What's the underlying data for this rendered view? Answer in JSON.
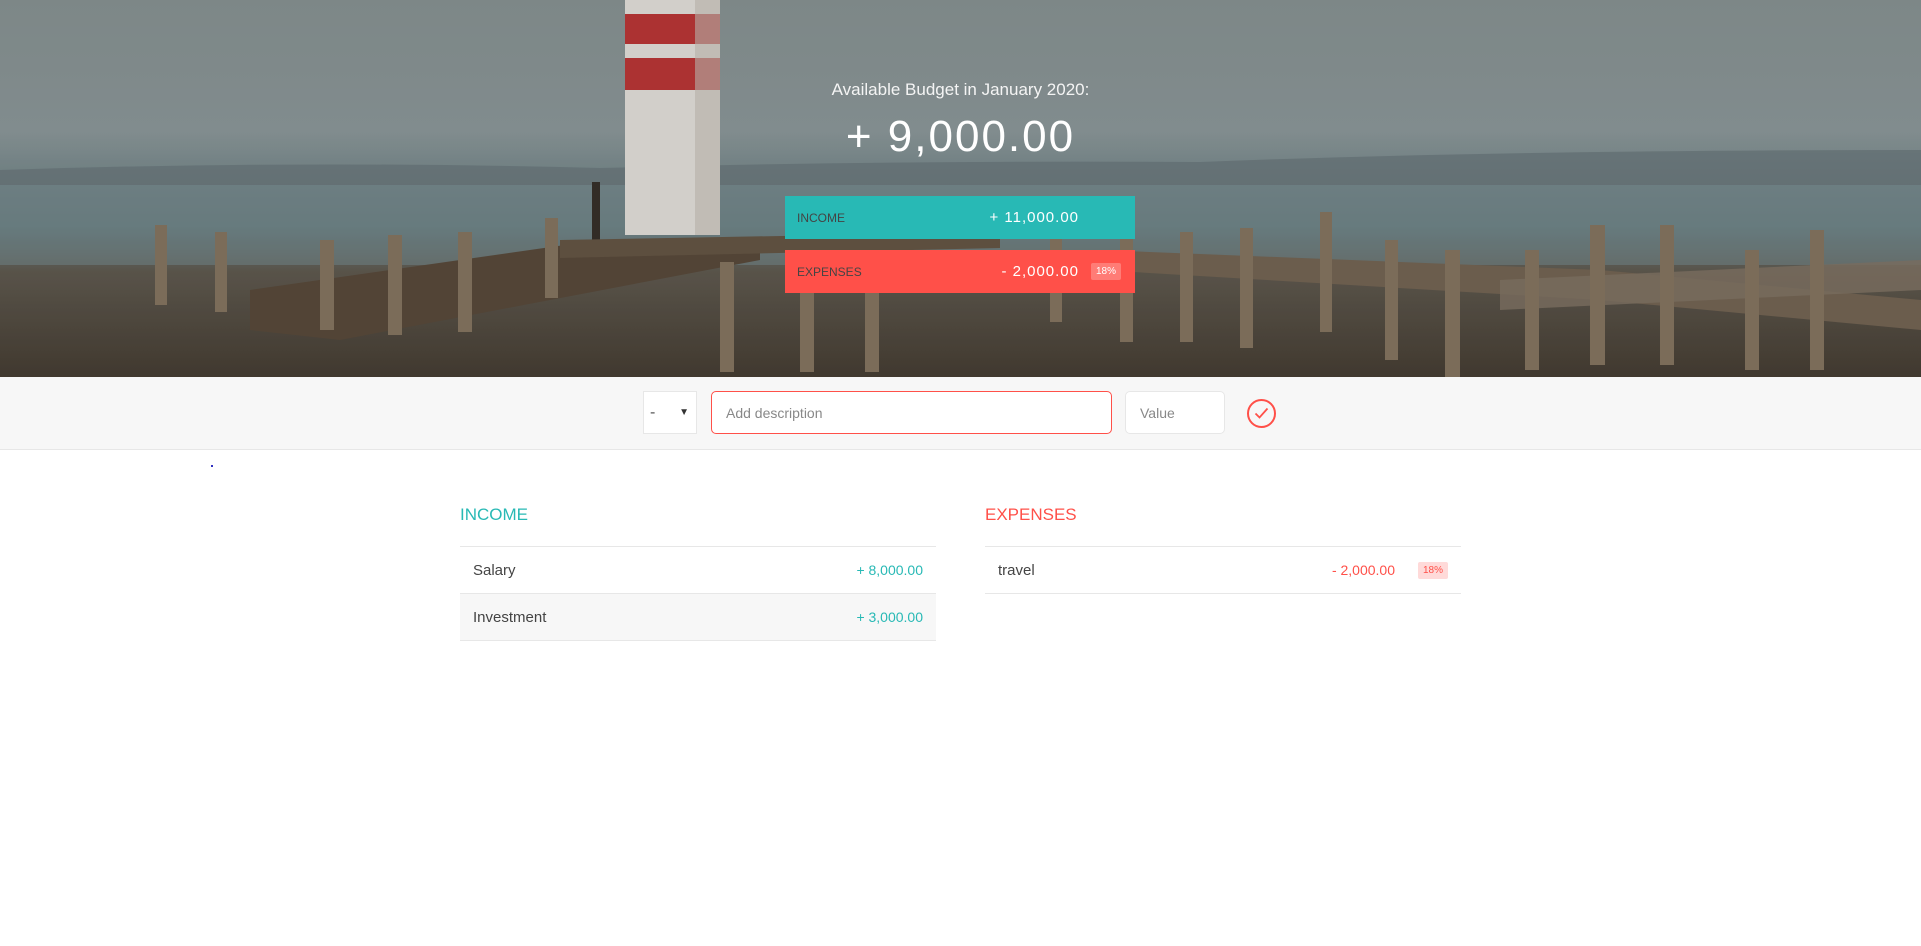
{
  "header": {
    "budget_title": "Available Budget in January 2020:",
    "budget_value": "+ 9,000.00",
    "income": {
      "label": "INCOME",
      "value": "+ 11,000.00"
    },
    "expenses": {
      "label": "EXPENSES",
      "value": "- 2,000.00",
      "percentage": "18%"
    }
  },
  "add_form": {
    "type_value": "-",
    "description_placeholder": "Add description",
    "value_placeholder": "Value"
  },
  "income": {
    "title": "INCOME",
    "items": [
      {
        "description": "Salary",
        "value": "+ 8,000.00"
      },
      {
        "description": "Investment",
        "value": "+ 3,000.00"
      }
    ]
  },
  "expenses": {
    "title": "EXPENSES",
    "items": [
      {
        "description": "travel",
        "value": "- 2,000.00",
        "percentage": "18%"
      }
    ]
  },
  "colors": {
    "income": "#28b9b5",
    "expenses": "#ff5049"
  }
}
